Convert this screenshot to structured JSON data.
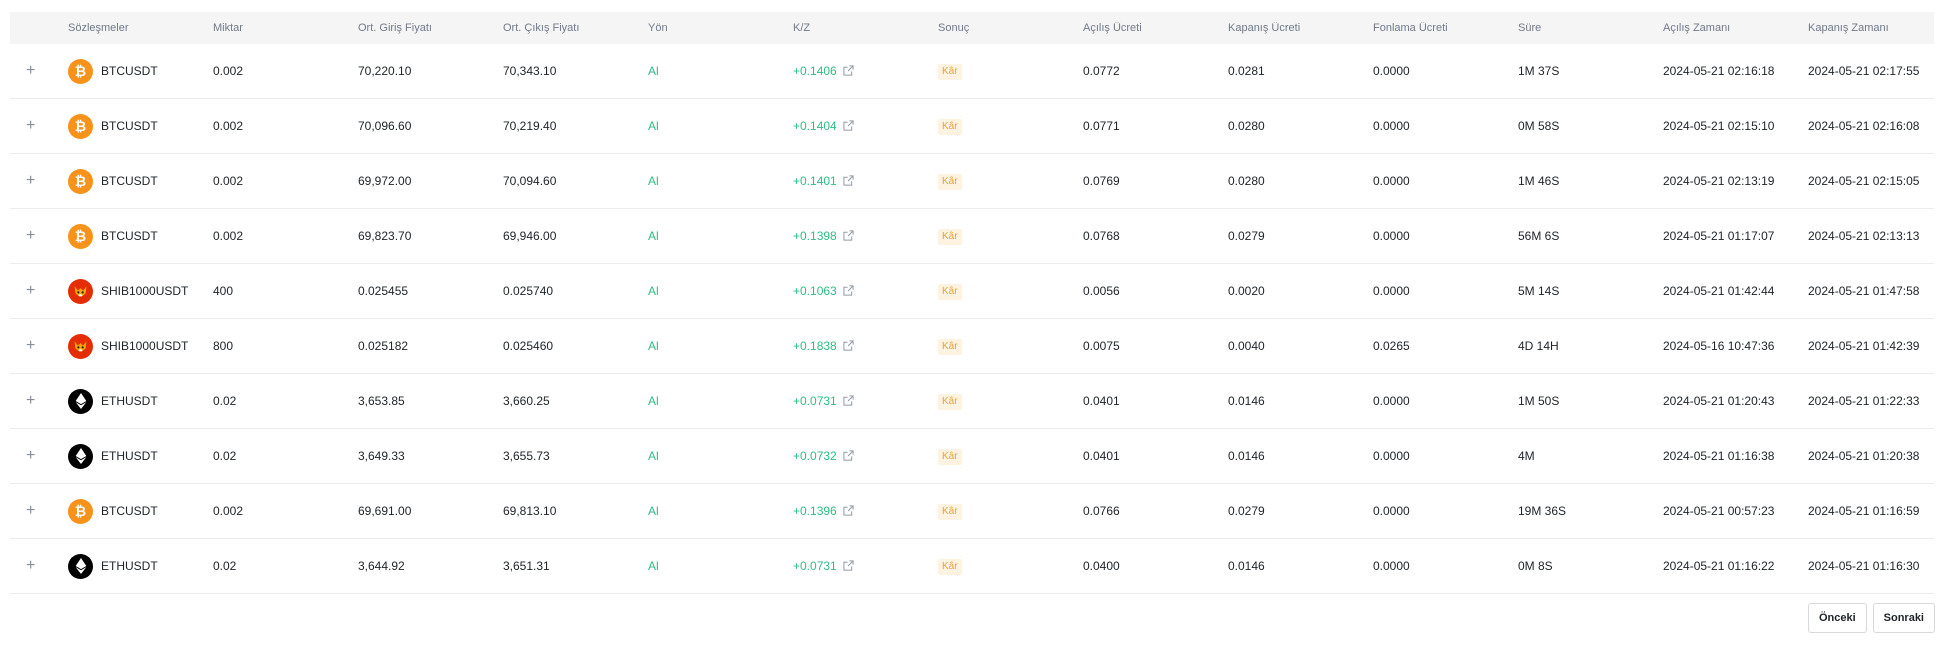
{
  "table": {
    "columns": [
      "Sözleşmeler",
      "Miktar",
      "Ort. Giriş Fiyatı",
      "Ort. Çıkış Fiyatı",
      "Yön",
      "K/Z",
      "Sonuç",
      "Açılış Ücreti",
      "Kapanış Ücreti",
      "Fonlama Ücreti",
      "Süre",
      "Açılış Zamanı",
      "Kapanış Zamanı"
    ],
    "expand_symbol": "+",
    "rows": [
      {
        "symbol": "BTCUSDT",
        "coin": "btc-coin-icon",
        "qty": "0.002",
        "entry": "70,220.10",
        "exit": "70,343.10",
        "side": "Al",
        "pnl": "+0.1406",
        "result": "Kâr",
        "open_fee": "0.0772",
        "close_fee": "0.0281",
        "funding_fee": "0.0000",
        "duration": "1M 37S",
        "open_time": "2024-05-21 02:16:18",
        "close_time": "2024-05-21 02:17:55"
      },
      {
        "symbol": "BTCUSDT",
        "coin": "btc-coin-icon",
        "qty": "0.002",
        "entry": "70,096.60",
        "exit": "70,219.40",
        "side": "Al",
        "pnl": "+0.1404",
        "result": "Kâr",
        "open_fee": "0.0771",
        "close_fee": "0.0280",
        "funding_fee": "0.0000",
        "duration": "0M 58S",
        "open_time": "2024-05-21 02:15:10",
        "close_time": "2024-05-21 02:16:08"
      },
      {
        "symbol": "BTCUSDT",
        "coin": "btc-coin-icon",
        "qty": "0.002",
        "entry": "69,972.00",
        "exit": "70,094.60",
        "side": "Al",
        "pnl": "+0.1401",
        "result": "Kâr",
        "open_fee": "0.0769",
        "close_fee": "0.0280",
        "funding_fee": "0.0000",
        "duration": "1M 46S",
        "open_time": "2024-05-21 02:13:19",
        "close_time": "2024-05-21 02:15:05"
      },
      {
        "symbol": "BTCUSDT",
        "coin": "btc-coin-icon",
        "qty": "0.002",
        "entry": "69,823.70",
        "exit": "69,946.00",
        "side": "Al",
        "pnl": "+0.1398",
        "result": "Kâr",
        "open_fee": "0.0768",
        "close_fee": "0.0279",
        "funding_fee": "0.0000",
        "duration": "56M 6S",
        "open_time": "2024-05-21 01:17:07",
        "close_time": "2024-05-21 02:13:13"
      },
      {
        "symbol": "SHIB1000USDT",
        "coin": "shib-coin-icon",
        "qty": "400",
        "entry": "0.025455",
        "exit": "0.025740",
        "side": "Al",
        "pnl": "+0.1063",
        "result": "Kâr",
        "open_fee": "0.0056",
        "close_fee": "0.0020",
        "funding_fee": "0.0000",
        "duration": "5M 14S",
        "open_time": "2024-05-21 01:42:44",
        "close_time": "2024-05-21 01:47:58"
      },
      {
        "symbol": "SHIB1000USDT",
        "coin": "shib-coin-icon",
        "qty": "800",
        "entry": "0.025182",
        "exit": "0.025460",
        "side": "Al",
        "pnl": "+0.1838",
        "result": "Kâr",
        "open_fee": "0.0075",
        "close_fee": "0.0040",
        "funding_fee": "0.0265",
        "duration": "4D 14H",
        "open_time": "2024-05-16 10:47:36",
        "close_time": "2024-05-21 01:42:39"
      },
      {
        "symbol": "ETHUSDT",
        "coin": "eth-coin-icon",
        "qty": "0.02",
        "entry": "3,653.85",
        "exit": "3,660.25",
        "side": "Al",
        "pnl": "+0.0731",
        "result": "Kâr",
        "open_fee": "0.0401",
        "close_fee": "0.0146",
        "funding_fee": "0.0000",
        "duration": "1M 50S",
        "open_time": "2024-05-21 01:20:43",
        "close_time": "2024-05-21 01:22:33"
      },
      {
        "symbol": "ETHUSDT",
        "coin": "eth-coin-icon",
        "qty": "0.02",
        "entry": "3,649.33",
        "exit": "3,655.73",
        "side": "Al",
        "pnl": "+0.0732",
        "result": "Kâr",
        "open_fee": "0.0401",
        "close_fee": "0.0146",
        "funding_fee": "0.0000",
        "duration": "4M",
        "open_time": "2024-05-21 01:16:38",
        "close_time": "2024-05-21 01:20:38"
      },
      {
        "symbol": "BTCUSDT",
        "coin": "btc-coin-icon",
        "qty": "0.002",
        "entry": "69,691.00",
        "exit": "69,813.10",
        "side": "Al",
        "pnl": "+0.1396",
        "result": "Kâr",
        "open_fee": "0.0766",
        "close_fee": "0.0279",
        "funding_fee": "0.0000",
        "duration": "19M 36S",
        "open_time": "2024-05-21 00:57:23",
        "close_time": "2024-05-21 01:16:59"
      },
      {
        "symbol": "ETHUSDT",
        "coin": "eth-coin-icon",
        "qty": "0.02",
        "entry": "3,644.92",
        "exit": "3,651.31",
        "side": "Al",
        "pnl": "+0.0731",
        "result": "Kâr",
        "open_fee": "0.0400",
        "close_fee": "0.0146",
        "funding_fee": "0.0000",
        "duration": "0M 8S",
        "open_time": "2024-05-21 01:16:22",
        "close_time": "2024-05-21 01:16:30"
      }
    ]
  },
  "pagination": {
    "prev_label": "Önceki",
    "next_label": "Sonraki"
  },
  "colors": {
    "buy": "#2ebd85",
    "profit_badge_bg": "#fdf3e0",
    "profit_badge_text": "#e6a23c",
    "btc": "#f7931a",
    "shib": "#e42d04",
    "eth": "#000000"
  }
}
